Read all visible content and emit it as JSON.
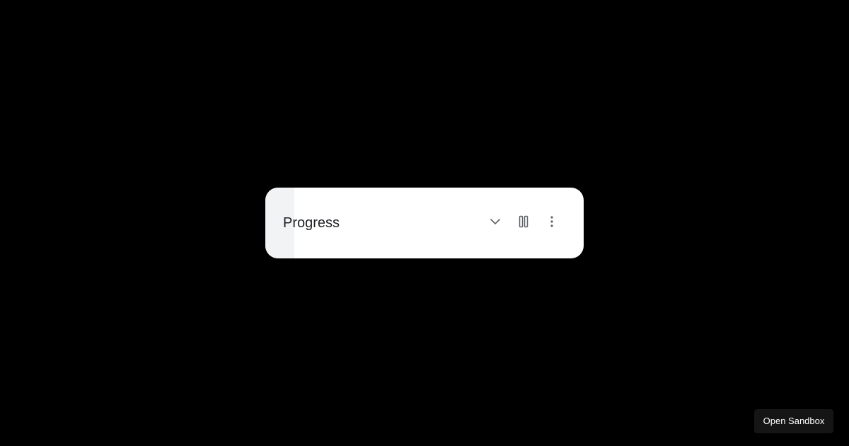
{
  "widget": {
    "title": "Progress",
    "progress": 0.09,
    "colors": {
      "card_bg": "#ffffff",
      "progress_fill": "#f1f3f4",
      "icon": "#5f6368",
      "text": "#202124"
    },
    "icons": {
      "expand": "chevron-down-icon",
      "pause": "pause-icon",
      "more": "more-vert-icon"
    }
  },
  "footer": {
    "open_sandbox_label": "Open Sandbox"
  }
}
